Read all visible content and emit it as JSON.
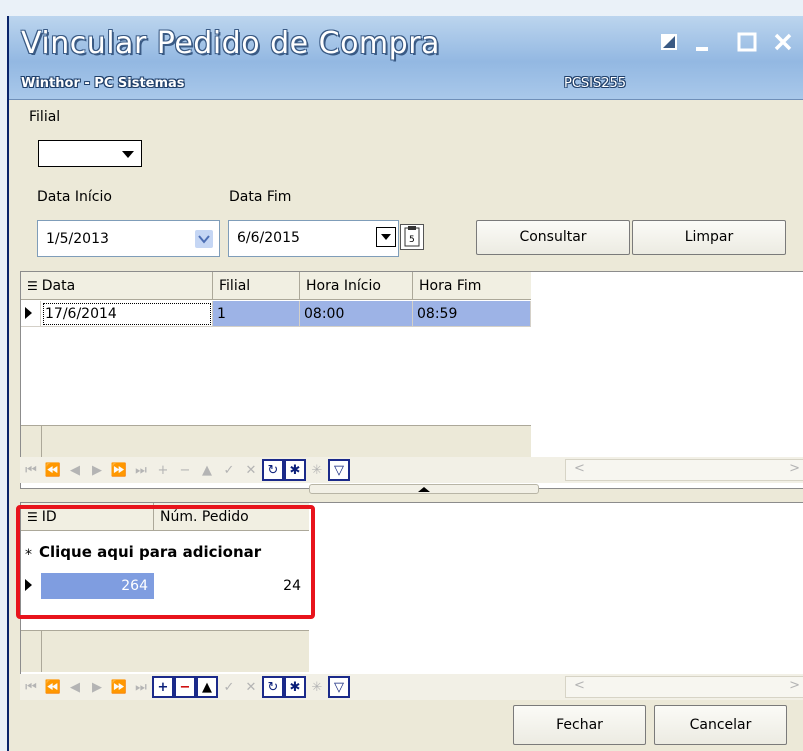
{
  "window": {
    "title": "Vincular Pedido de Compra",
    "subtitle": "Winthor - PC Sistemas",
    "code": "PCSIS255"
  },
  "filters": {
    "filial_label": "Filial",
    "filial_value": "",
    "data_inicio_label": "Data Início",
    "data_inicio_value": "1/5/2013",
    "data_fim_label": "Data Fim",
    "data_fim_value": "6/6/2015",
    "consultar_label": "Consultar",
    "limpar_label": "Limpar"
  },
  "top_grid": {
    "columns": [
      "Data",
      "Filial",
      "Hora Início",
      "Hora Fim"
    ],
    "rows": [
      [
        "17/6/2014",
        "1",
        "08:00",
        "08:59"
      ]
    ]
  },
  "bottom_grid": {
    "columns": [
      "ID",
      "Núm. Pedido"
    ],
    "new_row_text": "Clique aqui para adicionar",
    "new_row_marker": "*",
    "rows": [
      [
        "264",
        "24"
      ]
    ]
  },
  "footer": {
    "fechar_label": "Fechar",
    "cancelar_label": "Cancelar"
  },
  "colors": {
    "selection": "#9db3e6",
    "highlight_border": "#e8141c",
    "title_bar": "#93b8e2"
  },
  "icons": {
    "nav": [
      "first-icon",
      "prior-page-icon",
      "prior-icon",
      "next-icon",
      "next-page-icon",
      "last-icon",
      "insert-icon",
      "delete-icon",
      "edit-icon",
      "post-icon",
      "cancel-icon",
      "refresh-icon",
      "bookmark-icon",
      "goto-bookmark-icon",
      "filter-icon"
    ]
  }
}
